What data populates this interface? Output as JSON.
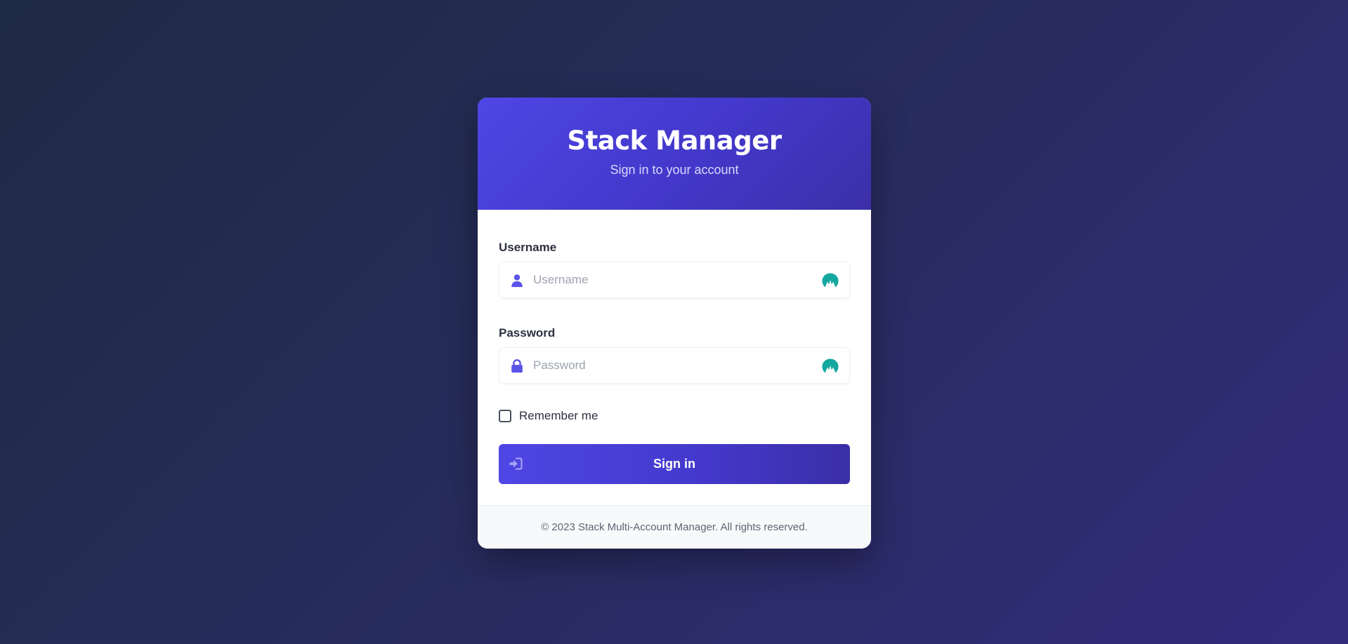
{
  "header": {
    "title": "Stack Manager",
    "subtitle": "Sign in to your account"
  },
  "form": {
    "username": {
      "label": "Username",
      "placeholder": "Username",
      "value": "",
      "leading_icon": "user-icon",
      "trailing_icon": "password-manager-icon"
    },
    "password": {
      "label": "Password",
      "placeholder": "Password",
      "value": "",
      "leading_icon": "lock-icon",
      "trailing_icon": "password-manager-icon"
    },
    "remember": {
      "label": "Remember me",
      "checked": false
    },
    "submit": {
      "label": "Sign in",
      "icon": "sign-in-icon"
    }
  },
  "footer": {
    "text": "© 2023 Stack Multi-Account Manager. All rights reserved."
  },
  "colors": {
    "primary": "#4f46e5",
    "primary_dark": "#3b30a8",
    "password_manager_icon": "#14a8a0",
    "background": "#262c5a"
  }
}
